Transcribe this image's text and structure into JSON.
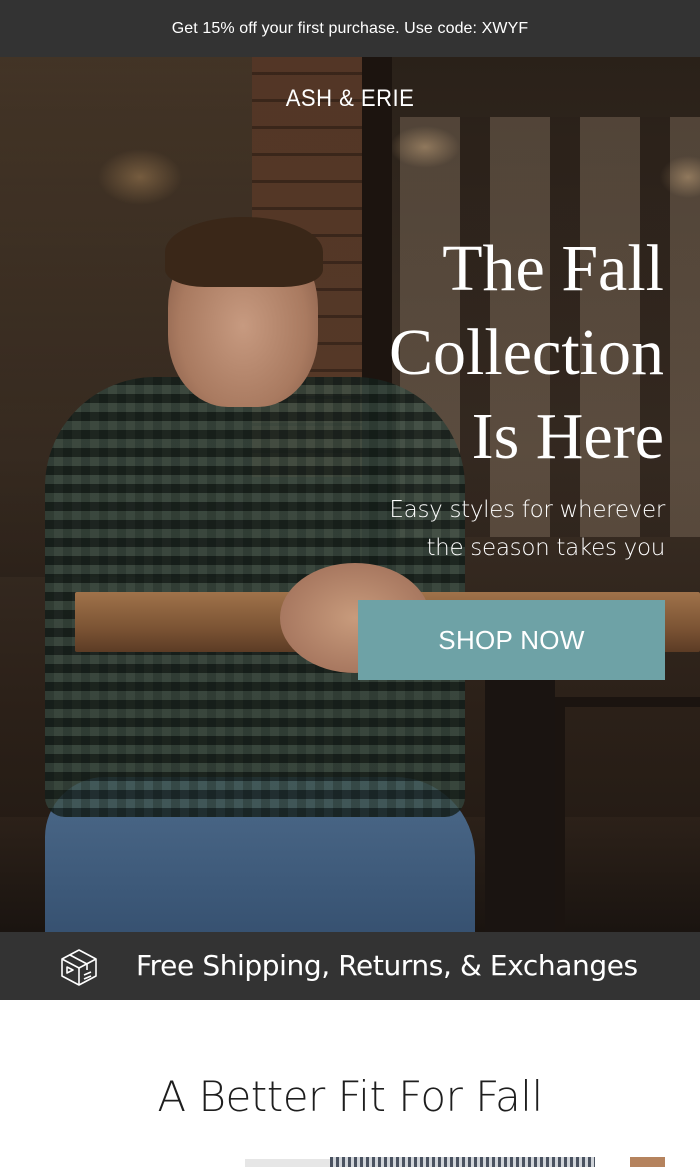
{
  "promo": {
    "text": "Get 15% off your first purchase. Use code: XWYF"
  },
  "hero": {
    "brand": "ASH & ERIE",
    "title": "The Fall\nCollection\nIs Here",
    "subtitle": "Easy styles for wherever\nthe season takes you",
    "cta_label": "SHOP NOW",
    "cta_color": "#6ea2a6"
  },
  "shipping": {
    "icon": "package-box-icon",
    "text": "Free Shipping, Returns, & Exchanges"
  },
  "section": {
    "title": "A Better Fit For Fall"
  },
  "colors": {
    "bar_background": "#333333",
    "page_background": "#ffffff"
  }
}
